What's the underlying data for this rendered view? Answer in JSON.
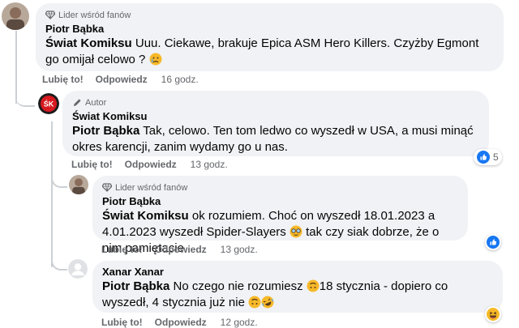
{
  "comments": [
    {
      "badge": "Lider wśród fanów",
      "author": "Piotr Bąbka",
      "mention": "Świat Komiksu",
      "text": " Uuu. Ciekawe, brakuje Epica ASM Hero Killers. Czyżby Egmont go omijał celowo ? ",
      "actions": {
        "like": "Lubię to!",
        "reply": "Odpowiedz",
        "time": "16 godz."
      }
    },
    {
      "badge": "Autor",
      "author": "Świat Komiksu",
      "mention": "Piotr Bąbka",
      "text": " Tak, celowo. Ten tom ledwo co wyszedł w USA, a musi minąć okres karencji, zanim wydamy go u nas.",
      "actions": {
        "like": "Lubię to!",
        "reply": "Odpowiedz",
        "time": "13 godz."
      },
      "reaction_count": "5"
    },
    {
      "badge": "Lider wśród fanów",
      "author": "Piotr Bąbka",
      "mention": "Świat Komiksu",
      "text_a": " ok rozumiem. Choć on wyszedł 18.01.2023 a 4.01.2023 wyszedł Spider-Slayers ",
      "text_b": " tak czy siak dobrze, że o nim pamiętacie",
      "actions": {
        "like": "Lubię to!",
        "reply": "Odpowiedz",
        "time": "13 godz."
      }
    },
    {
      "author": "Xanar Xanar",
      "mention": "Piotr Bąbka",
      "text_a": " No czego nie rozumiesz ",
      "text_b": "18 stycznia - dopiero co wyszedł, 4 stycznia już nie ",
      "actions": {
        "like": "Lubię to!",
        "reply": "Odpowiedz",
        "time": "12 godz."
      }
    }
  ],
  "icons": {
    "fan_badge": "diamond-icon",
    "author_badge": "pencil-icon",
    "like_reaction": "thumbs-up-icon",
    "haha_reaction": "laughing-emoji-icon"
  },
  "colors": {
    "bubble": "#f0f2f5",
    "meta": "#65676b",
    "like_blue": "#1877f2"
  }
}
